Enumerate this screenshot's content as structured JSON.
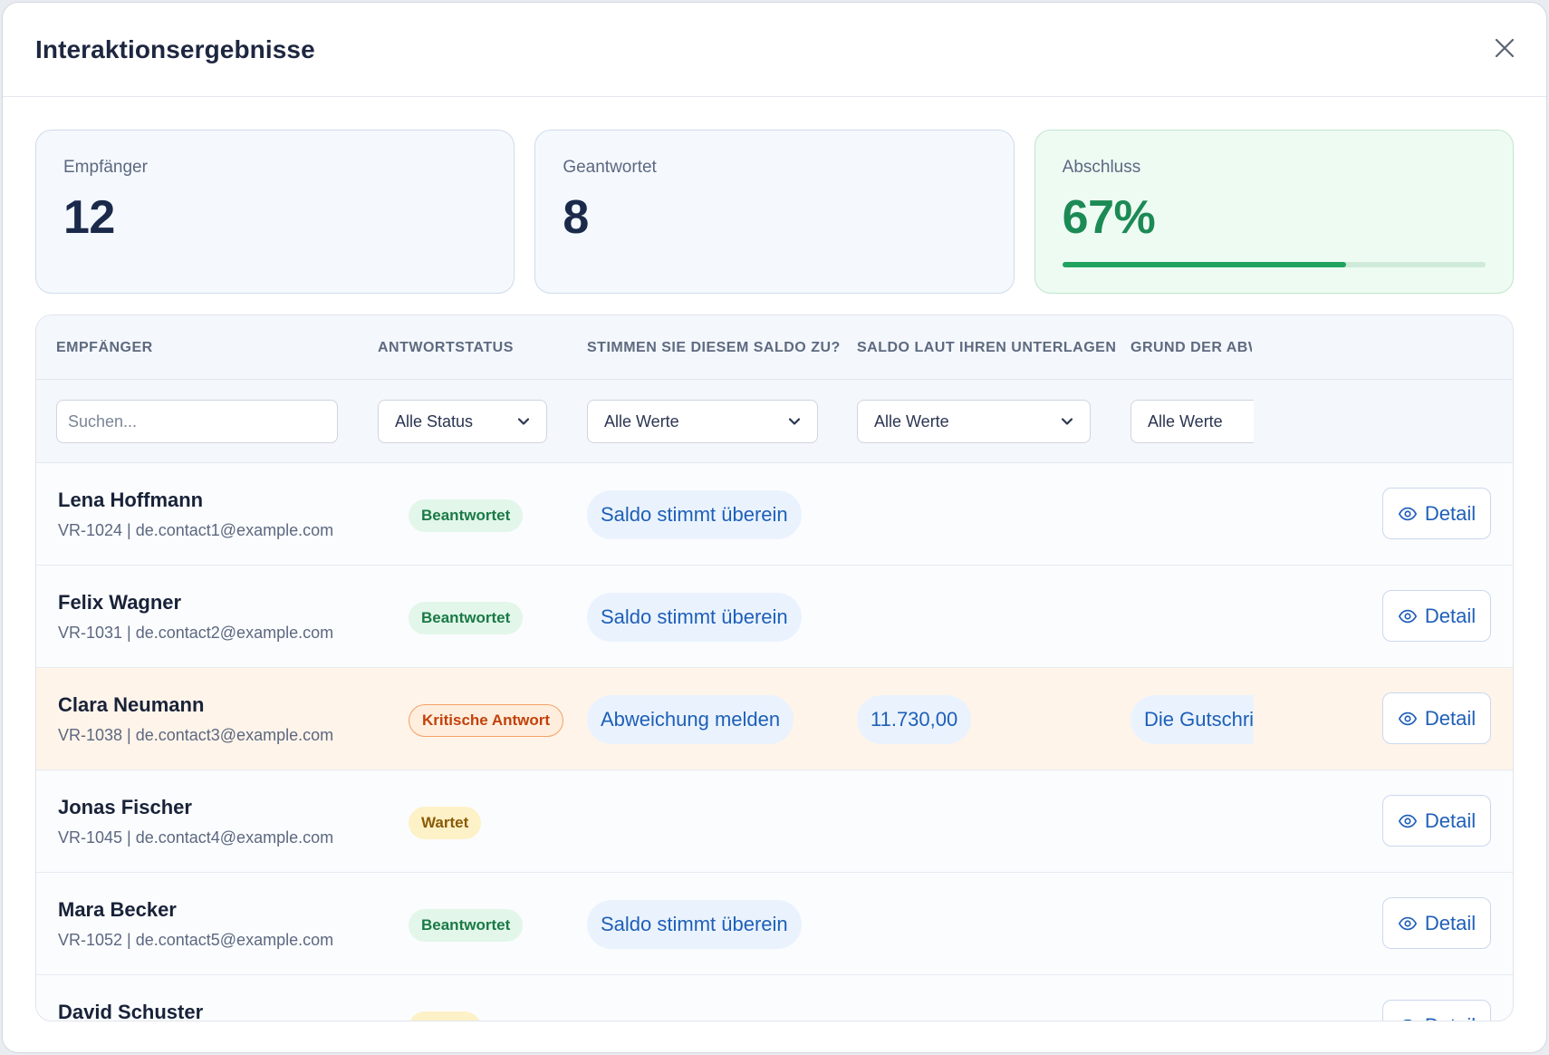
{
  "modal": {
    "title": "Interaktionsergebnisse"
  },
  "stats": [
    {
      "label": "Empfänger",
      "value": "12"
    },
    {
      "label": "Geantwortet",
      "value": "8"
    },
    {
      "label": "Abschluss",
      "value": "67%",
      "progress": 0.67
    }
  ],
  "table": {
    "headers": [
      "EMPFÄNGER",
      "ANTWORTSTATUS",
      "STIMMEN SIE DIESEM SALDO ZU?",
      "SALDO LAUT IHREN UNTERLAGEN",
      "GRUND DER ABW"
    ],
    "filters": {
      "search_placeholder": "Suchen...",
      "status": "Alle Status",
      "agree": "Alle Werte",
      "balance": "Alle Werte",
      "reason": "Alle Werte"
    },
    "detail_label": "Detail",
    "rows": [
      {
        "name": "Lena Hoffmann",
        "sub": "VR-1024 | de.contact1@example.com",
        "status": "Beantwortet",
        "agree": "Saldo stimmt überein",
        "balance": "",
        "reason": ""
      },
      {
        "name": "Felix Wagner",
        "sub": "VR-1031 | de.contact2@example.com",
        "status": "Beantwortet",
        "agree": "Saldo stimmt überein",
        "balance": "",
        "reason": ""
      },
      {
        "name": "Clara Neumann",
        "sub": "VR-1038 | de.contact3@example.com",
        "status": "Kritische Antwort",
        "agree": "Abweichung melden",
        "balance": "11.730,00",
        "reason": "Die Gutschrift"
      },
      {
        "name": "Jonas Fischer",
        "sub": "VR-1045 | de.contact4@example.com",
        "status": "Wartet",
        "agree": "",
        "balance": "",
        "reason": ""
      },
      {
        "name": "Mara Becker",
        "sub": "VR-1052 | de.contact5@example.com",
        "status": "Beantwortet",
        "agree": "Saldo stimmt überein",
        "balance": "",
        "reason": ""
      },
      {
        "name": "David Schuster",
        "sub": "",
        "status": "Wartet",
        "agree": "",
        "balance": "",
        "reason": ""
      }
    ]
  },
  "colors": {
    "accent": "#1e5fb8",
    "success": "#1c8a55",
    "critical": "#c2410c",
    "waiting": "#8a5a06"
  },
  "icons": {
    "close": "close-icon",
    "detail": "eye-icon",
    "select": "chevron-down-icon"
  }
}
